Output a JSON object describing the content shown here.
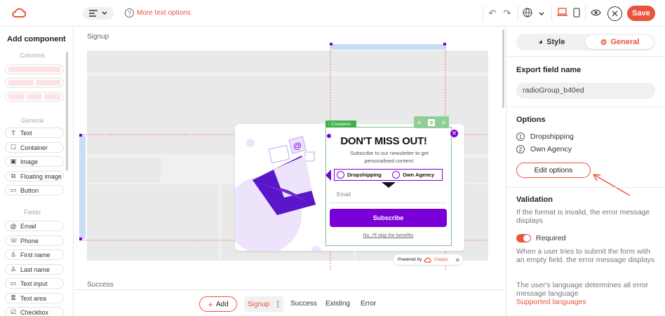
{
  "topbar": {
    "help_label": "More text options"
  },
  "left": {
    "title": "Add component",
    "columns_label": "Columns",
    "general_label": "General",
    "general_items": [
      "Text",
      "Container",
      "Image",
      "Floating image",
      "Button"
    ],
    "fields_label": "Fields",
    "field_items": [
      "Email",
      "Phone",
      "First name",
      "Last name",
      "Text input",
      "Text area",
      "Checkbox"
    ]
  },
  "canvas": {
    "section_top": "Signup",
    "section_bottom": "Success",
    "container_tag": "Container",
    "popup": {
      "headline": "DON'T MISS OUT!",
      "subtext": "Subscribe to our newsletter to get personalised content:",
      "radio_options": [
        "Dropshipping",
        "Own Agency"
      ],
      "email_placeholder": "Email",
      "subscribe_label": "Subscribe",
      "skip_label": "No, I'll skip the benefits",
      "powered_label": "Powered by",
      "brand": "Claspo"
    }
  },
  "bottom": {
    "add_label": "Add",
    "tabs": [
      "Signup",
      "Success",
      "Existing",
      "Error"
    ],
    "active_tab": "Signup"
  },
  "right": {
    "tabs": [
      "Style",
      "General"
    ],
    "active_tab": "General",
    "export_title": "Export field name",
    "export_value": "radioGroup_b40ed",
    "options_title": "Options",
    "options": [
      "Dropshipping",
      "Own Agency"
    ],
    "edit_label": "Edit options",
    "validation_title": "Validation",
    "validation_text": "If the format is invalid, the error message displays",
    "required_label": "Required",
    "required_text": "When a user tries to submit the form with an empty field, the error message displays",
    "language_text": "The user's language determines all error message language",
    "languages_link": "Supported languages"
  },
  "colors": {
    "accent": "#e8553e",
    "brand_purple": "#7a00d8",
    "container_green": "#3db24a"
  }
}
